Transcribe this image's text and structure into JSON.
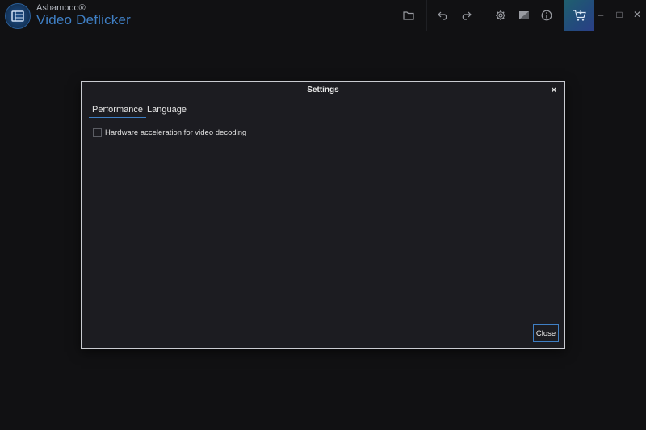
{
  "app": {
    "brand_small": "Ashampoo®",
    "brand_name": "Video Deflicker"
  },
  "toolbar": {
    "icons": [
      "folder-icon",
      "undo-icon",
      "redo-icon",
      "gear-icon",
      "image-icon",
      "info-icon",
      "cart-icon"
    ]
  },
  "window_controls": {
    "minimize": "–",
    "maximize": "□",
    "close": "✕"
  },
  "dialog": {
    "title": "Settings",
    "close_x": "×",
    "tabs": [
      {
        "label": "Performance",
        "active": true
      },
      {
        "label": "Language",
        "active": false
      }
    ],
    "options": [
      {
        "label": "Hardware acceleration for video decoding",
        "checked": false
      }
    ],
    "close_button": "Close"
  },
  "colors": {
    "accent": "#3f7fc4",
    "background": "#111113",
    "dialog_bg": "#1c1c21"
  }
}
